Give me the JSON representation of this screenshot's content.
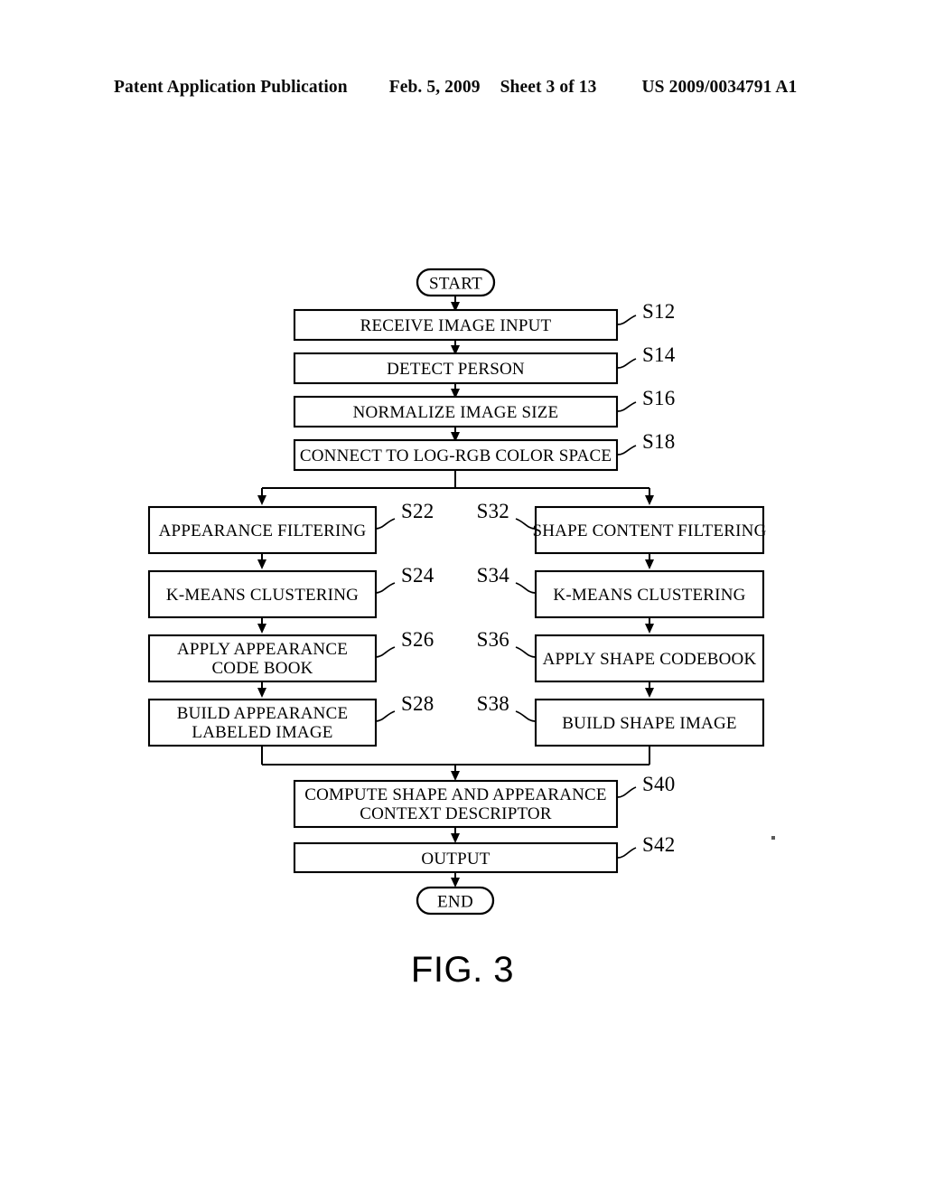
{
  "header": {
    "publication": "Patent Application Publication",
    "date": "Feb. 5, 2009",
    "sheet": "Sheet 3 of 13",
    "document_number": "US 2009/0034791 A1"
  },
  "figure": {
    "caption": "FIG. 3",
    "start_label": "START",
    "end_label": "END"
  },
  "chart_data": {
    "type": "diagram",
    "diagram_kind": "flowchart",
    "title": "FIG. 3",
    "orientation": "top-to-bottom with two parallel branches",
    "nodes": [
      {
        "id": "start",
        "shape": "terminator",
        "label": "START",
        "tag": ""
      },
      {
        "id": "s12",
        "shape": "process",
        "label": "RECEIVE IMAGE INPUT",
        "tag": "S12",
        "tag_side": "right"
      },
      {
        "id": "s14",
        "shape": "process",
        "label": "DETECT PERSON",
        "tag": "S14",
        "tag_side": "right"
      },
      {
        "id": "s16",
        "shape": "process",
        "label": "NORMALIZE IMAGE SIZE",
        "tag": "S16",
        "tag_side": "right"
      },
      {
        "id": "s18",
        "shape": "process",
        "label": "CONNECT TO LOG-RGB COLOR SPACE",
        "tag": "S18",
        "tag_side": "right"
      },
      {
        "id": "s22",
        "shape": "process",
        "label": "APPEARANCE FILTERING",
        "tag": "S22",
        "tag_side": "right",
        "branch": "left"
      },
      {
        "id": "s24",
        "shape": "process",
        "label": "K-MEANS CLUSTERING",
        "tag": "S24",
        "tag_side": "right",
        "branch": "left"
      },
      {
        "id": "s26",
        "shape": "process",
        "label": "APPLY APPEARANCE\nCODE BOOK",
        "tag": "S26",
        "tag_side": "right",
        "branch": "left"
      },
      {
        "id": "s28",
        "shape": "process",
        "label": "BUILD APPEARANCE\nLABELED IMAGE",
        "tag": "S28",
        "tag_side": "right",
        "branch": "left"
      },
      {
        "id": "s32",
        "shape": "process",
        "label": "SHAPE CONTENT FILTERING",
        "tag": "S32",
        "tag_side": "left",
        "branch": "right"
      },
      {
        "id": "s34",
        "shape": "process",
        "label": "K-MEANS CLUSTERING",
        "tag": "S34",
        "tag_side": "left",
        "branch": "right"
      },
      {
        "id": "s36",
        "shape": "process",
        "label": "APPLY SHAPE CODEBOOK",
        "tag": "S36",
        "tag_side": "left",
        "branch": "right"
      },
      {
        "id": "s38",
        "shape": "process",
        "label": "BUILD SHAPE IMAGE",
        "tag": "S38",
        "tag_side": "left",
        "branch": "right"
      },
      {
        "id": "s40",
        "shape": "process",
        "label": "COMPUTE SHAPE AND APPEARANCE\nCONTEXT DESCRIPTOR",
        "tag": "S40",
        "tag_side": "right"
      },
      {
        "id": "s42",
        "shape": "process",
        "label": "OUTPUT",
        "tag": "S42",
        "tag_side": "right"
      },
      {
        "id": "end",
        "shape": "terminator",
        "label": "END",
        "tag": ""
      }
    ],
    "edges": [
      {
        "from": "start",
        "to": "s12"
      },
      {
        "from": "s12",
        "to": "s14"
      },
      {
        "from": "s14",
        "to": "s16"
      },
      {
        "from": "s16",
        "to": "s18"
      },
      {
        "from": "s18",
        "to": "s22",
        "kind": "split"
      },
      {
        "from": "s18",
        "to": "s32",
        "kind": "split"
      },
      {
        "from": "s22",
        "to": "s24"
      },
      {
        "from": "s24",
        "to": "s26"
      },
      {
        "from": "s26",
        "to": "s28"
      },
      {
        "from": "s32",
        "to": "s34"
      },
      {
        "from": "s34",
        "to": "s36"
      },
      {
        "from": "s36",
        "to": "s38"
      },
      {
        "from": "s28",
        "to": "s40",
        "kind": "merge"
      },
      {
        "from": "s38",
        "to": "s40",
        "kind": "merge"
      },
      {
        "from": "s40",
        "to": "s42"
      },
      {
        "from": "s42",
        "to": "end"
      }
    ]
  },
  "nodes": {
    "start": {
      "label": "START"
    },
    "s12": {
      "label": "RECEIVE IMAGE INPUT",
      "tag": "S12"
    },
    "s14": {
      "label": "DETECT PERSON",
      "tag": "S14"
    },
    "s16": {
      "label": "NORMALIZE IMAGE SIZE",
      "tag": "S16"
    },
    "s18": {
      "label": "CONNECT TO LOG-RGB COLOR SPACE",
      "tag": "S18"
    },
    "s22": {
      "label": "APPEARANCE FILTERING",
      "tag": "S22"
    },
    "s24": {
      "label": "K-MEANS CLUSTERING",
      "tag": "S24"
    },
    "s26": {
      "label_line1": "APPLY APPEARANCE",
      "label_line2": "CODE BOOK",
      "tag": "S26"
    },
    "s28": {
      "label_line1": "BUILD APPEARANCE",
      "label_line2": "LABELED IMAGE",
      "tag": "S28"
    },
    "s32": {
      "label": "SHAPE CONTENT FILTERING",
      "tag": "S32"
    },
    "s34": {
      "label": "K-MEANS CLUSTERING",
      "tag": "S34"
    },
    "s36": {
      "label": "APPLY SHAPE CODEBOOK",
      "tag": "S36"
    },
    "s38": {
      "label": "BUILD SHAPE IMAGE",
      "tag": "S38"
    },
    "s40": {
      "label_line1": "COMPUTE SHAPE AND APPEARANCE",
      "label_line2": "CONTEXT DESCRIPTOR",
      "tag": "S40"
    },
    "s42": {
      "label": "OUTPUT",
      "tag": "S42"
    },
    "end": {
      "label": "END"
    }
  },
  "colors": {
    "ink": "#000000",
    "paper": "#ffffff"
  }
}
